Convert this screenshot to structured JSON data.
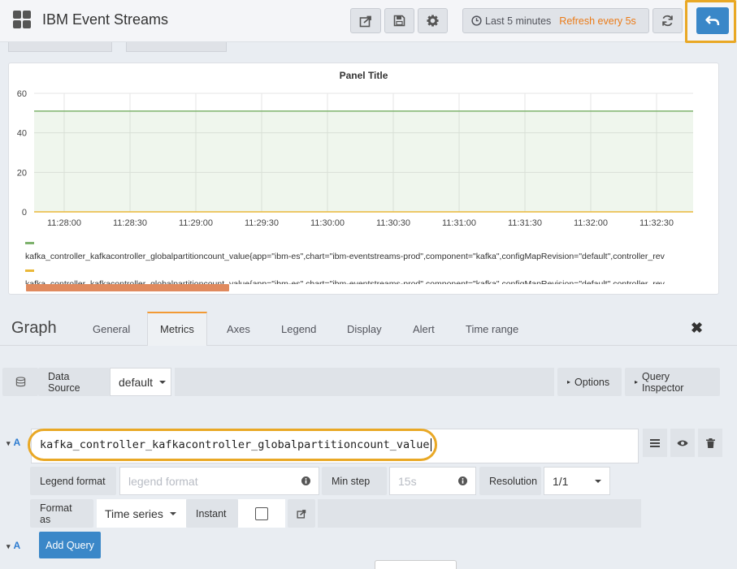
{
  "navbar": {
    "title": "IBM Event Streams",
    "time_range": "Last 5 minutes",
    "refresh": "Refresh every 5s",
    "icons": [
      "dashboard-grid-icon",
      "share-icon",
      "save-icon",
      "gear-icon",
      "clock-icon",
      "refresh-icon",
      "back-arrow-icon"
    ],
    "accent_color": "#3a87c8",
    "highlight_color": "#e9a825"
  },
  "panel": {
    "title": "Panel Title",
    "legend": [
      {
        "text": "kafka_controller_kafkacontroller_globalpartitioncount_value{app=\"ibm-es\",chart=\"ibm-eventstreams-prod\",component=\"kafka\",configMapRevision=\"default\",controller_rev",
        "color": "#7eb26d"
      },
      {
        "text": "kafka_controller_kafkacontroller_globalpartitioncount_value{app=\"ibm-es\",chart=\"ibm-eventstreams-prod\",component=\"kafka\",configMapRevision=\"default\",controller_rev",
        "color": "#eab839"
      }
    ]
  },
  "chart_data": {
    "type": "area",
    "title": "Panel Title",
    "x": [
      "11:28:00",
      "11:28:30",
      "11:29:00",
      "11:29:30",
      "11:30:00",
      "11:30:30",
      "11:31:00",
      "11:31:30",
      "11:32:00",
      "11:32:30"
    ],
    "yticks": [
      0,
      20,
      40,
      60
    ],
    "ylim": [
      0,
      60
    ],
    "grid": true,
    "series": [
      {
        "values": [
          51,
          51,
          51,
          51,
          51,
          51,
          51,
          51,
          51,
          51
        ],
        "color": "#7eb26d"
      },
      {
        "values": [
          0,
          0,
          0,
          0,
          0,
          0,
          0,
          0,
          0,
          0
        ],
        "color": "#eab839"
      }
    ]
  },
  "editor": {
    "title": "Graph",
    "tabs": [
      "General",
      "Metrics",
      "Axes",
      "Legend",
      "Display",
      "Alert",
      "Time range"
    ],
    "active_tab": "Metrics",
    "data_source_label": "Data Source",
    "data_source_value": "default",
    "options_label": "Options",
    "query_inspector_label": "Query Inspector",
    "query_letter": "A",
    "query_expr": "kafka_controller_kafkacontroller_globalpartitioncount_value",
    "legend_format_label": "Legend format",
    "legend_format_placeholder": "legend format",
    "min_step_label": "Min step",
    "min_step_placeholder": "15s",
    "resolution_label": "Resolution",
    "resolution_value": "1/1",
    "format_as_label": "Format as",
    "format_as_value": "Time series",
    "instant_label": "Instant",
    "instant_checked": false,
    "add_query_label": "Add Query"
  }
}
